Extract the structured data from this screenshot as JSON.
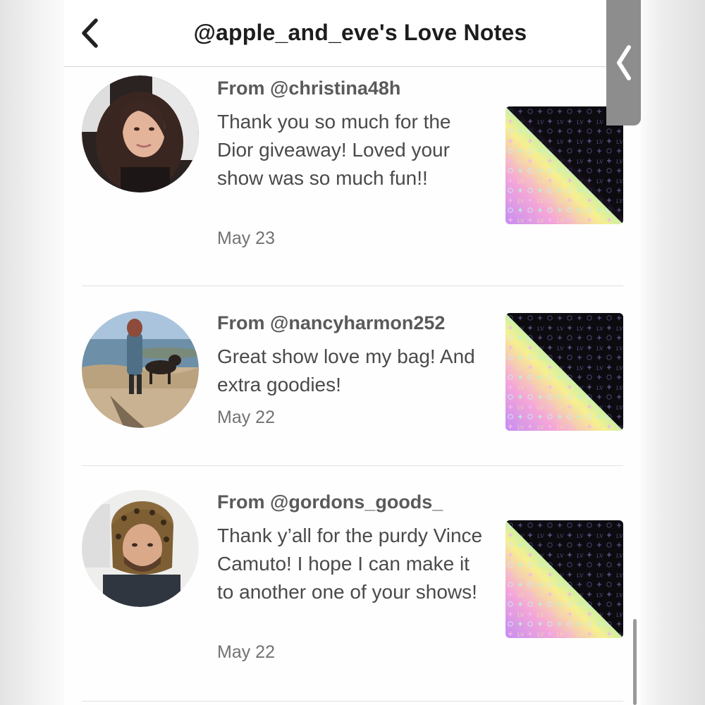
{
  "header": {
    "title": "@apple_and_eve's Love Notes",
    "back_icon": "chevron-left-icon",
    "side_tab_icon": "chevron-left-icon"
  },
  "notes": [
    {
      "from": "From @christina48h",
      "message": "Thank you so much for the Dior giveaway! Loved your show was so much fun!!",
      "date": "May 23"
    },
    {
      "from": "From @nancyharmon252",
      "message": "Great show love my bag! And extra goodies!",
      "date": "May 22"
    },
    {
      "from": "From @gordons_goods_",
      "message": "Thank y’all for the purdy Vince Camuto! I hope I can make it to another one of your shows!",
      "date": "May 22"
    }
  ],
  "colors": {
    "title": "#1d1d1d",
    "from": "#5a5a5a",
    "message": "#4a4a4a",
    "date": "#727272",
    "side_tab": "#8d8d8d"
  }
}
